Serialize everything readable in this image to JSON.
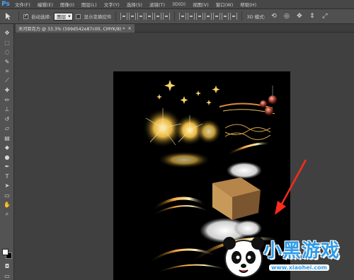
{
  "app": {
    "logo": "Ps"
  },
  "menu": {
    "items": [
      "文件(F)",
      "编辑(E)",
      "图像(I)",
      "图层(L)",
      "文字(Y)",
      "选择(S)",
      "滤镜(T)",
      "3D(D)",
      "视图(V)",
      "窗口(W)",
      "帮助(H)"
    ]
  },
  "options": {
    "auto_select_label": "自动选择:",
    "auto_select_checked": true,
    "auto_select_value": "图层",
    "show_transform_label": "显示变换控件",
    "mode_3d_label": "3D 模式:"
  },
  "document_tab": {
    "title": "天河亚克力 @ 33.3% (599d542e87c00, CMYK/8) *",
    "close_symbol": "×"
  },
  "colors": {
    "foreground": "#ffffff",
    "background": "#000000",
    "arrow": "#ff2a1a",
    "accent": "#4aa3f5"
  },
  "watermark": {
    "text_cn": "小黑游戏",
    "url": "www.xiaohei.com"
  },
  "tools": [
    "move-icon",
    "marquee-icon",
    "lasso-icon",
    "quick-select-icon",
    "crop-icon",
    "eyedropper-icon",
    "healing-icon",
    "brush-icon",
    "stamp-icon",
    "history-brush-icon",
    "eraser-icon",
    "gradient-icon",
    "blur-icon",
    "dodge-icon",
    "pen-icon",
    "type-icon",
    "path-select-icon",
    "shape-icon",
    "hand-icon",
    "zoom-icon"
  ]
}
